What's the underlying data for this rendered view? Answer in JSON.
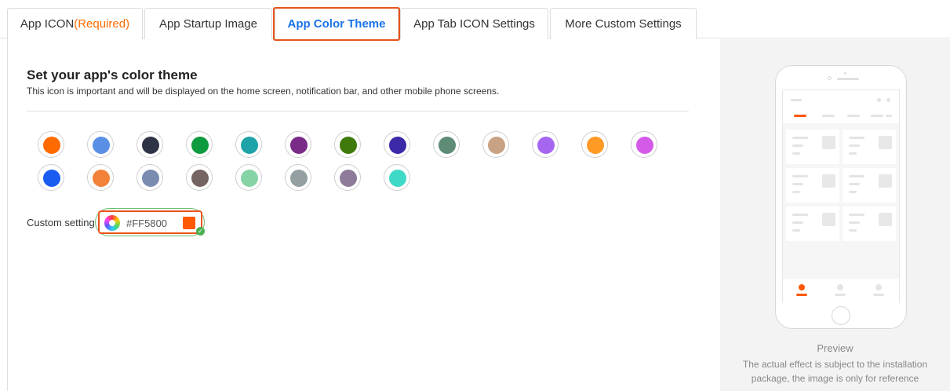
{
  "tabs": [
    {
      "label": "App ICON",
      "suffix": "(Required)"
    },
    {
      "label": "App Startup Image"
    },
    {
      "label": "App Color Theme",
      "active": true
    },
    {
      "label": "App Tab ICON Settings"
    },
    {
      "label": "More Custom Settings"
    }
  ],
  "theme": {
    "title": "Set your app's color theme",
    "subtitle": "This icon is important and will be displayed on the home screen, notification bar, and other mobile phone screens.",
    "swatches_row1": [
      "#FF6A00",
      "#5A8FE6",
      "#2E3445",
      "#0E9A3E",
      "#1FA3A8",
      "#7A2A87",
      "#3F7A0A",
      "#3A2AA8",
      "#5E8C77",
      "#C9A284",
      "#A566F0",
      "#FF9A26",
      "#D45AE8"
    ],
    "swatches_row2": [
      "#1A5CF2",
      "#F2813A",
      "#7A8DB0",
      "#766462",
      "#86D4A6",
      "#939FA1",
      "#8E7A99",
      "#3FD9C7"
    ]
  },
  "custom": {
    "label": "Custom setting",
    "value": "#FF5800",
    "color": "#FF5800"
  },
  "preview": {
    "title": "Preview",
    "note_line1": "The actual effect is subject to the installation",
    "note_line2": "package, the image is only for reference",
    "accent": "#FF5800"
  }
}
